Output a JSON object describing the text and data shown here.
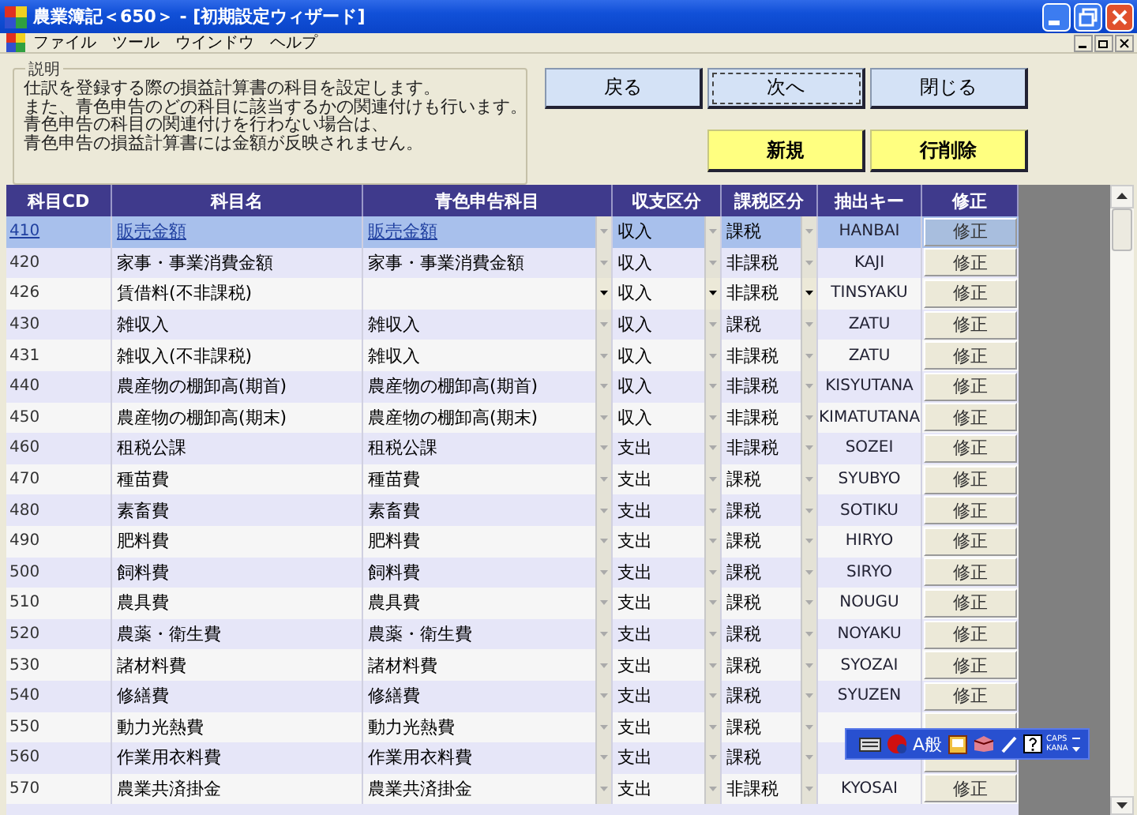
{
  "window": {
    "title": "農業簿記＜650＞ - [初期設定ウィザード]"
  },
  "menu": [
    "ファイル",
    "ツール",
    "ウインドウ",
    "ヘルプ"
  ],
  "description": {
    "legend": "説明",
    "lines": [
      "仕訳を登録する際の損益計算書の科目を設定します。",
      "また、青色申告のどの科目に該当するかの関連付けも行います。",
      "青色申告の科目の関連付けを行わない場合は、",
      "青色申告の損益計算書には金額が反映されません。"
    ]
  },
  "nav_buttons": [
    {
      "label": "戻る",
      "focused": false
    },
    {
      "label": "次へ",
      "focused": true
    },
    {
      "label": "閉じる",
      "focused": false
    }
  ],
  "action_buttons": [
    "新規",
    "行削除"
  ],
  "table": {
    "columns": [
      "科目CD",
      "科目名",
      "青色申告科目",
      "収支区分",
      "課税区分",
      "抽出キー",
      "修正"
    ],
    "rows": [
      {
        "code": "410",
        "name": "販売金額",
        "blue_item": "販売金額",
        "income": "収入",
        "tax": "課税",
        "key": "HANBAI",
        "edit": "修正",
        "selected": true,
        "active": false
      },
      {
        "code": "420",
        "name": "家事・事業消費金額",
        "blue_item": "家事・事業消費金額",
        "income": "収入",
        "tax": "非課税",
        "key": "KAJI",
        "edit": "修正",
        "selected": false,
        "active": false
      },
      {
        "code": "426",
        "name": "賃借料(不非課税)",
        "income": "収入",
        "tax": "非課税",
        "key": "TINSYAKU",
        "edit": "修正",
        "selected": false,
        "active": true
      },
      {
        "code": "430",
        "name": "雑収入",
        "blue_item": "雑収入",
        "income": "収入",
        "tax": "課税",
        "key": "ZATU",
        "edit": "修正",
        "selected": false,
        "active": false
      },
      {
        "code": "431",
        "name": "雑収入(不非課税)",
        "blue_item": "雑収入",
        "income": "収入",
        "tax": "非課税",
        "key": "ZATU",
        "edit": "修正",
        "selected": false,
        "active": false
      },
      {
        "code": "440",
        "name": "農産物の棚卸高(期首)",
        "blue_item": "農産物の棚卸高(期首)",
        "income": "収入",
        "tax": "非課税",
        "key": "KISYUTANA",
        "edit": "修正",
        "selected": false,
        "active": false
      },
      {
        "code": "450",
        "name": "農産物の棚卸高(期末)",
        "blue_item": "農産物の棚卸高(期末)",
        "income": "収入",
        "tax": "非課税",
        "key": "KIMATUTANA",
        "edit": "修正",
        "selected": false,
        "active": false
      },
      {
        "code": "460",
        "name": "租税公課",
        "blue_item": "租税公課",
        "income": "支出",
        "tax": "非課税",
        "key": "SOZEI",
        "edit": "修正",
        "selected": false,
        "active": false
      },
      {
        "code": "470",
        "name": "種苗費",
        "blue_item": "種苗費",
        "income": "支出",
        "tax": "課税",
        "key": "SYUBYO",
        "edit": "修正",
        "selected": false,
        "active": false
      },
      {
        "code": "480",
        "name": "素畜費",
        "blue_item": "素畜費",
        "income": "支出",
        "tax": "課税",
        "key": "SOTIKU",
        "edit": "修正",
        "selected": false,
        "active": false
      },
      {
        "code": "490",
        "name": "肥料費",
        "blue_item": "肥料費",
        "income": "支出",
        "tax": "課税",
        "key": "HIRYO",
        "edit": "修正",
        "selected": false,
        "active": false
      },
      {
        "code": "500",
        "name": "飼料費",
        "blue_item": "飼料費",
        "income": "支出",
        "tax": "課税",
        "key": "SIRYO",
        "edit": "修正",
        "selected": false,
        "active": false
      },
      {
        "code": "510",
        "name": "農具費",
        "blue_item": "農具費",
        "income": "支出",
        "tax": "課税",
        "key": "NOUGU",
        "edit": "修正",
        "selected": false,
        "active": false
      },
      {
        "code": "520",
        "name": "農薬・衛生費",
        "blue_item": "農薬・衛生費",
        "income": "支出",
        "tax": "課税",
        "key": "NOYAKU",
        "edit": "修正",
        "selected": false,
        "active": false
      },
      {
        "code": "530",
        "name": "諸材料費",
        "blue_item": "諸材料費",
        "income": "支出",
        "tax": "課税",
        "key": "SYOZAI",
        "edit": "修正",
        "selected": false,
        "active": false
      },
      {
        "code": "540",
        "name": "修繕費",
        "blue_item": "修繕費",
        "income": "支出",
        "tax": "課税",
        "key": "SYUZEN",
        "edit": "修正",
        "selected": false,
        "active": false
      },
      {
        "code": "550",
        "name": "動力光熱費",
        "blue_item": "動力光熱費",
        "income": "支出",
        "tax": "課税",
        "selected": false,
        "active": false
      },
      {
        "code": "560",
        "name": "作業用衣料費",
        "blue_item": "作業用衣料費",
        "income": "支出",
        "tax": "課税",
        "selected": false,
        "active": false
      },
      {
        "code": "570",
        "name": "農業共済掛金",
        "blue_item": "農業共済掛金",
        "income": "支出",
        "tax": "非課税",
        "key": "KYOSAI",
        "edit": "修正",
        "selected": false,
        "active": false
      }
    ]
  },
  "ime_bar": {
    "mode": "A般",
    "caps": "CAPS",
    "kana": "KANA"
  }
}
